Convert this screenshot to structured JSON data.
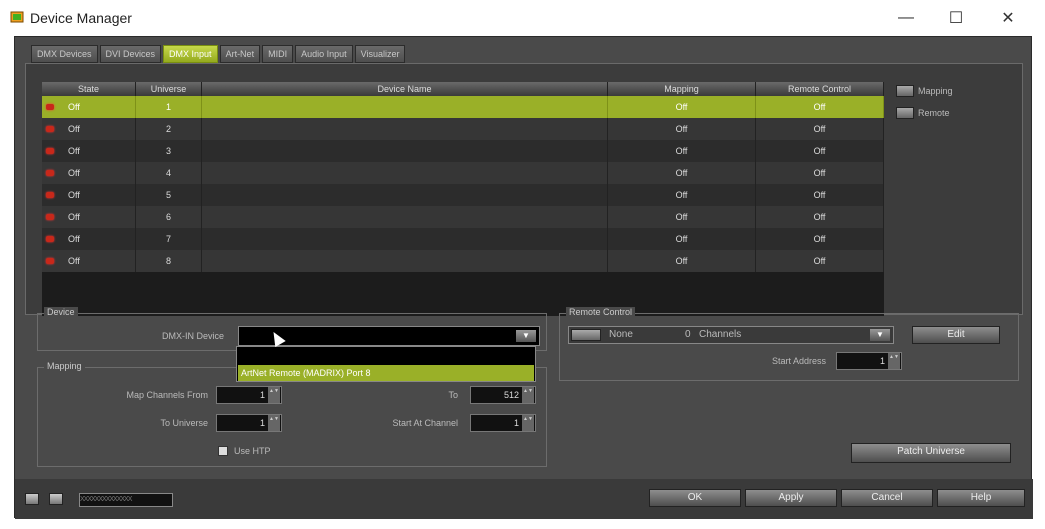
{
  "window": {
    "title": "Device Manager",
    "minimize": "—",
    "maximize": "☐",
    "close": "✕"
  },
  "tabs": [
    {
      "label": "DMX Devices",
      "active": false
    },
    {
      "label": "DVI Devices",
      "active": false
    },
    {
      "label": "DMX Input",
      "active": true
    },
    {
      "label": "Art-Net",
      "active": false
    },
    {
      "label": "MIDI",
      "active": false
    },
    {
      "label": "Audio Input",
      "active": false
    },
    {
      "label": "Visualizer",
      "active": false
    }
  ],
  "table": {
    "headers": {
      "state": "State",
      "universe": "Universe",
      "device_name": "Device Name",
      "mapping": "Mapping",
      "remote_control": "Remote Control"
    },
    "rows": [
      {
        "state": "Off",
        "universe": "1",
        "device_name": "",
        "mapping": "Off",
        "remote_control": "Off",
        "selected": true
      },
      {
        "state": "Off",
        "universe": "2",
        "device_name": "",
        "mapping": "Off",
        "remote_control": "Off",
        "selected": false
      },
      {
        "state": "Off",
        "universe": "3",
        "device_name": "",
        "mapping": "Off",
        "remote_control": "Off",
        "selected": false
      },
      {
        "state": "Off",
        "universe": "4",
        "device_name": "",
        "mapping": "Off",
        "remote_control": "Off",
        "selected": false
      },
      {
        "state": "Off",
        "universe": "5",
        "device_name": "",
        "mapping": "Off",
        "remote_control": "Off",
        "selected": false
      },
      {
        "state": "Off",
        "universe": "6",
        "device_name": "",
        "mapping": "Off",
        "remote_control": "Off",
        "selected": false
      },
      {
        "state": "Off",
        "universe": "7",
        "device_name": "",
        "mapping": "Off",
        "remote_control": "Off",
        "selected": false
      },
      {
        "state": "Off",
        "universe": "8",
        "device_name": "",
        "mapping": "Off",
        "remote_control": "Off",
        "selected": false
      }
    ]
  },
  "side_buttons": {
    "mapping": "Mapping",
    "remote": "Remote"
  },
  "device_group": {
    "label": "Device",
    "dmx_in_device_label": "DMX-IN Device",
    "dmx_in_device_value": "",
    "dropdown_option": "ArtNet Remote (MADRIX) Port 8"
  },
  "mapping_group": {
    "label": "Mapping",
    "map_channels_from_label": "Map Channels From",
    "map_channels_from_value": "1",
    "to_label": "To",
    "to_value": "512",
    "to_universe_label": "To Universe",
    "to_universe_value": "1",
    "start_at_channel_label": "Start At Channel",
    "start_at_channel_value": "1",
    "use_htp_label": "Use HTP",
    "use_htp_checked": true
  },
  "remote_group": {
    "label": "Remote Control",
    "preset_value": "None",
    "channels_count": "0",
    "channels_label": "Channels",
    "edit_label": "Edit",
    "start_address_label": "Start Address",
    "start_address_value": "1"
  },
  "buttons": {
    "patch_universe": "Patch Universe",
    "ok": "OK",
    "apply": "Apply",
    "cancel": "Cancel",
    "help": "Help"
  },
  "status": {
    "field_text": "XXXXXXXXXXXXXX"
  },
  "colors": {
    "accent": "#9ab028",
    "background": "#4a4a4a",
    "led_off": "#c8281a"
  },
  "icons": {
    "app": "device-manager-icon",
    "led": "red-led-icon"
  }
}
